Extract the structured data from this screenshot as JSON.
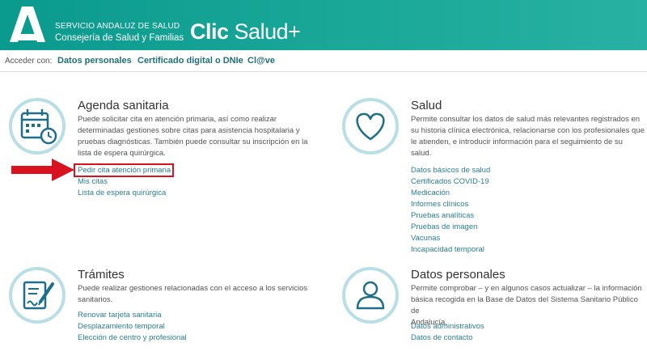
{
  "header": {
    "org_line1": "SERVICIO ANDALUZ DE SALUD",
    "org_line2": "Consejería de Salud y Familias",
    "brand_part1": "Clic",
    "brand_part2": "Salud+"
  },
  "access": {
    "label": "Acceder con:",
    "links": [
      "Datos personales",
      "Certificado digital o DNIe",
      "Cl@ve"
    ]
  },
  "cards": [
    {
      "title": "Agenda sanitaria",
      "icon": "calendar-clock-icon",
      "description": [
        "Puede solicitar cita en atención primaria, así como realizar",
        "determinadas gestiones sobre citas para asistencia hospitalaria y",
        "pruebas diagnósticas. También puede consultar su inscripción en la",
        "lista de espera quirúrgica."
      ],
      "links": [
        "Pedir cita atención primaria",
        "Mis citas",
        "Lista de espera quirúrgica"
      ]
    },
    {
      "title": "Salud",
      "icon": "heart-icon",
      "description": [
        "Permite consultar los datos de salud más relevantes registrados en",
        "su historia clínica electrónica, relacionarse con los profesionales que",
        "le atienden, e introducir información para el seguimiento de su",
        "salud."
      ],
      "links": [
        "Datos básicos de salud",
        "Certificados COVID-19",
        "Medicación",
        "Informes clínicos",
        "Pruebas analíticas",
        "Pruebas de imagen",
        "Vacunas",
        "Incapacidad temporal"
      ]
    },
    {
      "title": "Trámites",
      "icon": "document-pen-icon",
      "description": [
        "Puede realizar gestiones relacionadas con el acceso a los servicios",
        "sanitarios."
      ],
      "links": [
        "Renovar tarjeta sanitaria",
        "Desplazamiento temporal",
        "Elección de centro y profesional"
      ]
    },
    {
      "title": "Datos personales",
      "icon": "user-icon",
      "description": [
        "Permite comprobar – y en algunos casos actualizar – la información",
        "básica recogida en la Base de Datos del Sistema Sanitario Público de",
        "Andalucía."
      ],
      "links": [
        "Datos administrativos",
        "Datos de contacto"
      ]
    }
  ],
  "colors": {
    "header": "#1aa898",
    "link": "#2a7f93",
    "access_link": "#1f6f74",
    "icon_ring": "#b9dfe6",
    "icon_line": "#1f6f8b",
    "annotation": "#d8131f"
  }
}
